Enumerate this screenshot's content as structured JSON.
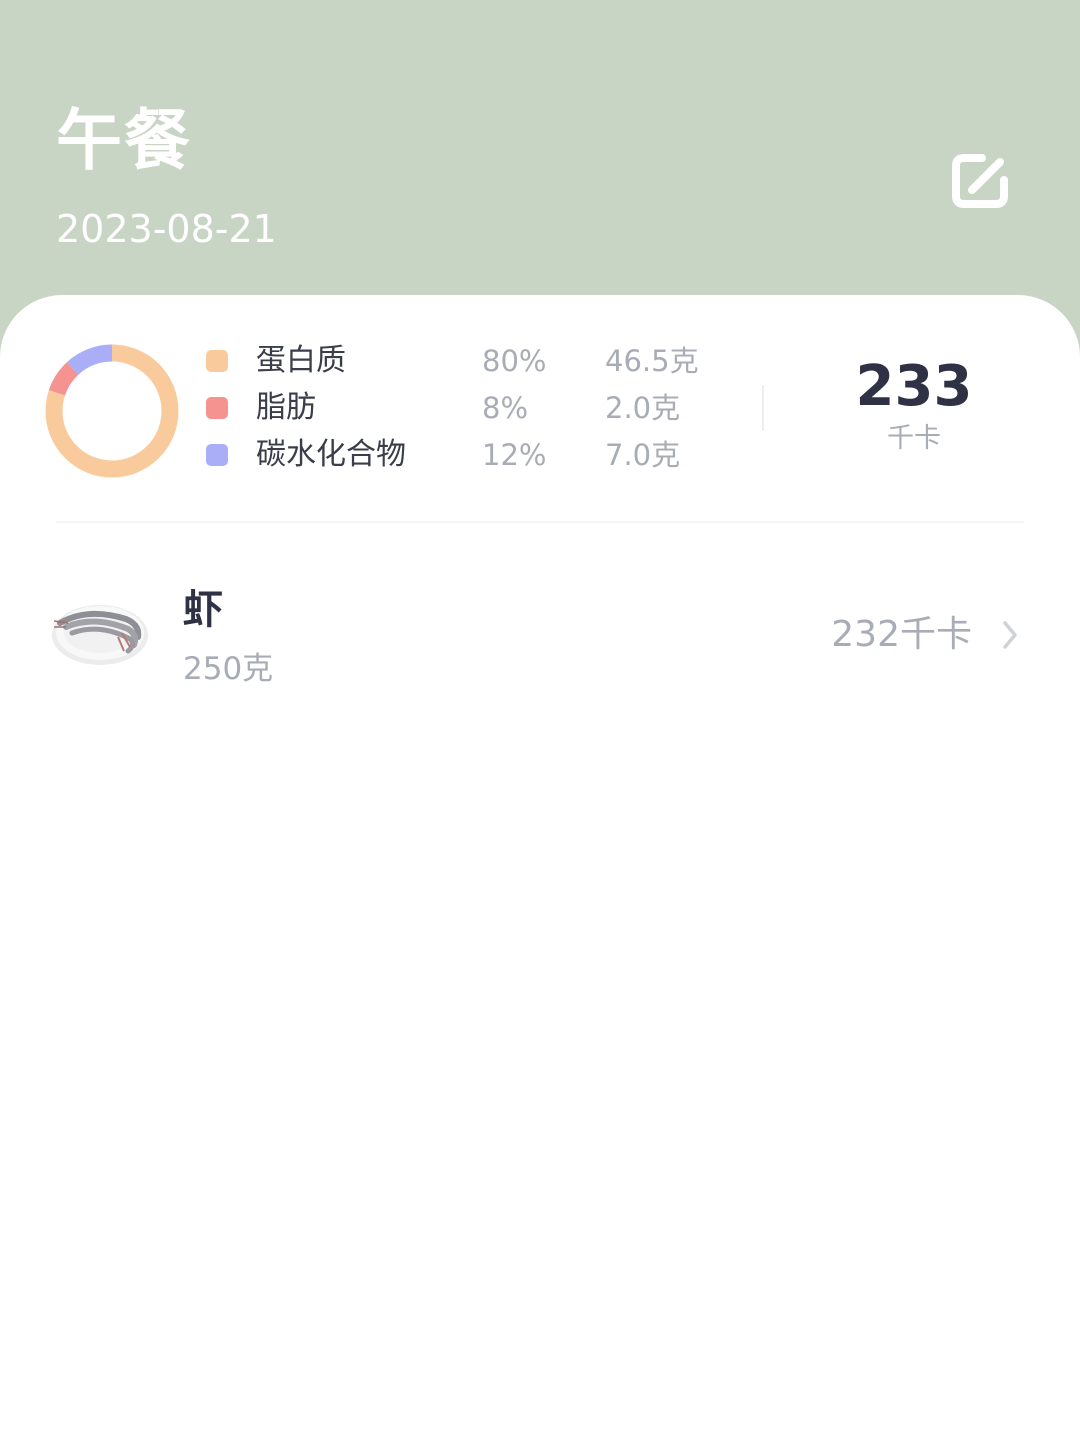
{
  "header": {
    "title": "午餐",
    "date": "2023-08-21",
    "edit_icon": "edit-icon"
  },
  "summary": {
    "macros": [
      {
        "name": "蛋白质",
        "percent": "80%",
        "amount": "46.5克",
        "color": "#f9cb9c"
      },
      {
        "name": "脂肪",
        "percent": "8%",
        "amount": "2.0克",
        "color": "#f4938f"
      },
      {
        "name": "碳水化合物",
        "percent": "12%",
        "amount": "7.0克",
        "color": "#aaaef6"
      }
    ],
    "total_kcal": "233",
    "total_unit": "千卡"
  },
  "foods": [
    {
      "name": "虾",
      "weight": "250克",
      "kcal": "232千卡",
      "icon": "shrimp-plate-icon"
    }
  ],
  "colors": {
    "header_bg": "#c9d5c4",
    "card_bg": "#ffffff",
    "text_dark": "#2e3244",
    "text_muted": "#a8acb6"
  }
}
